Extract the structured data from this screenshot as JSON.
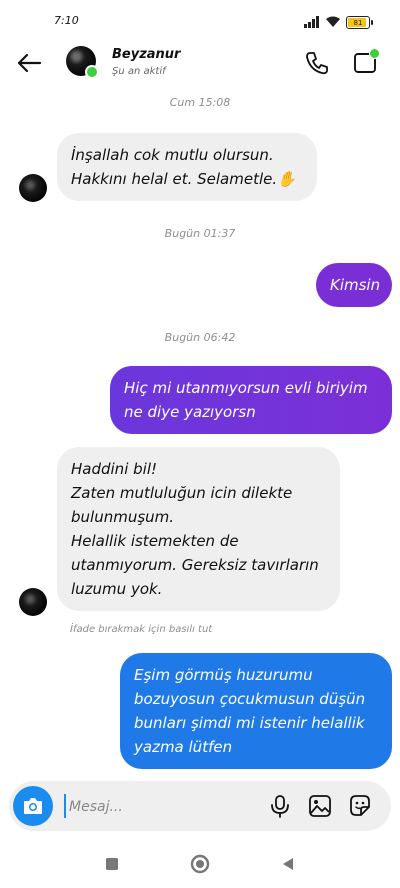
{
  "status_bar": {
    "time": "7:10",
    "battery": "81",
    "icons": [
      "signal-icon",
      "wifi-icon",
      "battery-icon"
    ]
  },
  "header": {
    "contact_name": "Beyzanur",
    "status": "Şu an aktif",
    "icons": [
      "back-arrow-icon",
      "phone-icon",
      "video-call-icon"
    ]
  },
  "conversation": {
    "timestamps": [
      "Cum 15:08",
      "Bugün 01:37",
      "Bugün 06:42"
    ],
    "messages": [
      {
        "direction": "incoming",
        "lines": [
          "İnşallah cok mutlu olursun.",
          "Hakkını helal et. Selametle.✋"
        ]
      },
      {
        "direction": "outgoing",
        "lines": [
          "Kimsin"
        ]
      },
      {
        "direction": "outgoing",
        "lines": [
          "Hiç mi utanmıyorsun evli biriyim",
          "ne diye yazıyorsn"
        ]
      },
      {
        "direction": "incoming",
        "lines": [
          "Haddini bil!",
          "Zaten mutluluğun icin dilekte",
          "bulunmuşum.",
          "Helallik istemekten de",
          "utanmıyorum. Gereksiz tavırların",
          "luzumu yok."
        ]
      },
      {
        "direction": "outgoing",
        "lines": [
          "Eşim görmüş huzurumu",
          "bozuyosun çocukmusun düşün",
          "bunları şimdi mi istenir helallik",
          "yazma lütfen"
        ]
      }
    ],
    "reaction_hint": "İfade bırakmak için basılı tut"
  },
  "composer": {
    "placeholder": "Mesaj...",
    "value": "",
    "icons": [
      "camera-icon",
      "microphone-icon",
      "gallery-icon",
      "sticker-icon"
    ]
  },
  "colors": {
    "accent": "#1a8cf0",
    "outgoing_purple": "#7a2fd6",
    "outgoing_blue": "#1f7ae8",
    "incoming_bg": "#efefef",
    "online": "#3bd13b"
  },
  "nav_bar": {
    "icons": [
      "recent-apps-icon",
      "home-icon",
      "back-icon"
    ]
  }
}
